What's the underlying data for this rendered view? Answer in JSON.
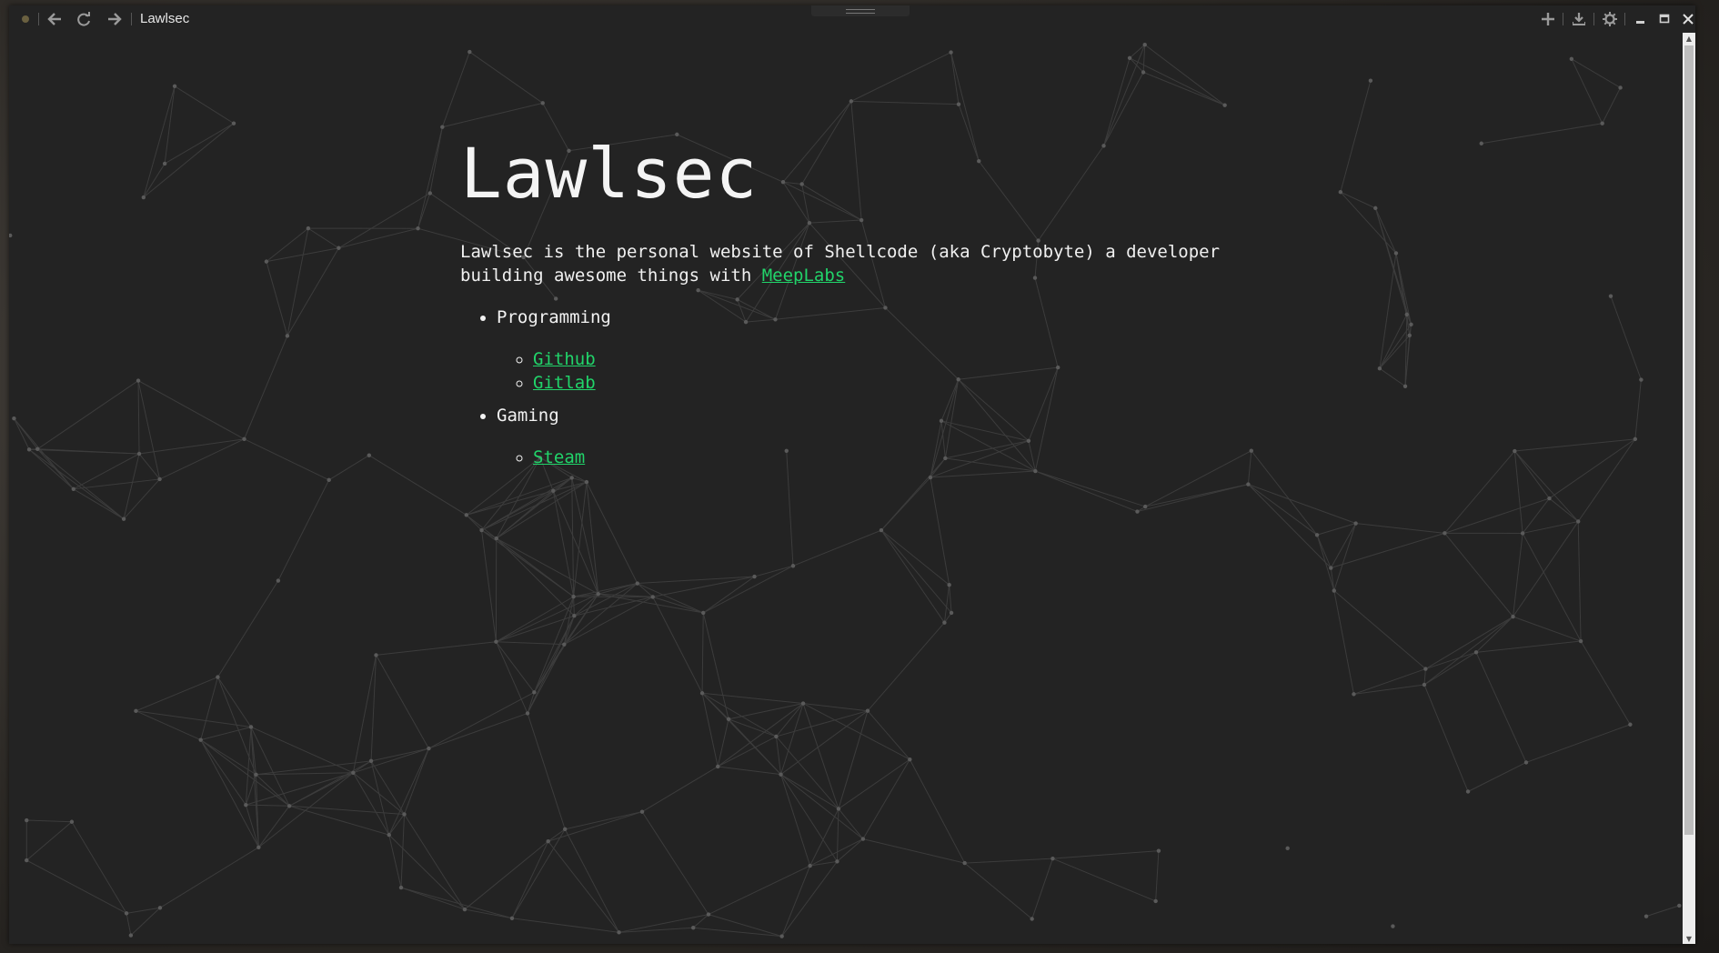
{
  "window": {
    "title": "Lawlsec"
  },
  "titlebar": {
    "app_icon": "app-logo-icon",
    "back_icon": "arrow-left-icon",
    "reload_icon": "reload-icon",
    "forward_icon": "arrow-right-icon",
    "new_tab_icon": "plus-icon",
    "download_icon": "download-icon",
    "settings_icon": "gear-icon",
    "minimize_icon": "minimize-icon",
    "maximize_icon": "maximize-icon",
    "close_icon": "close-icon"
  },
  "page": {
    "title": "Lawlsec",
    "intro_text": "Lawlsec is the personal website of Shellcode (aka Cryptobyte) a developer building awesome things with ",
    "intro_link": "MeepLabs",
    "sections": [
      {
        "label": "Programming",
        "links": [
          "Github",
          "Gitlab"
        ]
      },
      {
        "label": "Gaming",
        "links": [
          "Steam"
        ]
      }
    ]
  },
  "colors": {
    "background": "#232323",
    "text": "#f2f2f2",
    "link": "#21d46a",
    "network_lines": "#3c3c3c",
    "network_nodes": "#5a5a5a"
  }
}
